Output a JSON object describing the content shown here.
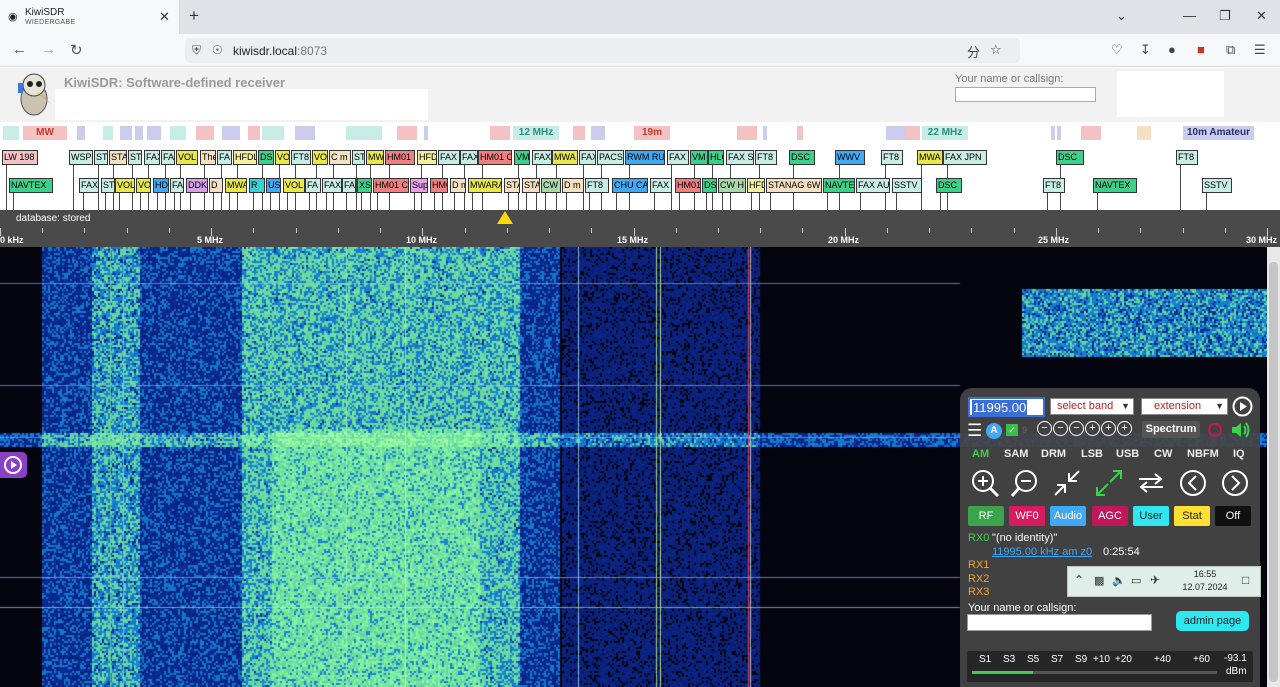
{
  "browser": {
    "tab_title": "KiwiSDR",
    "tab_subtitle": "WIEDERGABE",
    "url_host": "kiwisdr.local",
    "url_port": ":8073"
  },
  "header": {
    "title": "KiwiSDR: Software-defined receiver",
    "callsign_label": "Your name or callsign:"
  },
  "bands": [
    {
      "label": "MW",
      "color": "#f4c2c2",
      "text": "#c0392b"
    },
    {
      "label": "12 MHz",
      "color": "#c8ece6",
      "text": "#2a8f80"
    },
    {
      "label": "19m",
      "color": "#f4c2c2",
      "text": "#c0392b"
    },
    {
      "label": "22 MHz",
      "color": "#c8ece6",
      "text": "#2a8f80"
    },
    {
      "label": "10m Amateur",
      "color": "#ccccee",
      "text": "#223366"
    }
  ],
  "labels_row1": [
    "LW 198",
    "WSP",
    "ST",
    "STA",
    "ST",
    "FAX",
    "FA",
    "VOL",
    "The",
    "FA",
    "HFDL",
    "DS",
    "VO",
    "FT8",
    "VO",
    "C m",
    "ST",
    "MW",
    "HM01",
    "HFD",
    "FAX",
    "FAX",
    "HM01 C",
    "VM",
    "FAX",
    "MWA",
    "FAX",
    "PACS",
    "RWM RU",
    "FAX",
    "VM",
    "HLC",
    "FAX S",
    "FT8",
    "DSC",
    "WWV",
    "FT8",
    "MWA",
    "FAX JPN",
    "DSC",
    "FT8"
  ],
  "labels_row2": [
    "NAVTEX",
    "FAX",
    "ST",
    "VOL",
    "VO",
    "HD",
    "FA",
    "DDK",
    "D",
    "MWA",
    "R",
    "US",
    "VOL",
    "FA",
    "FAX",
    "FA",
    "XS",
    "HM01 C",
    "Sup",
    "HM0",
    "D m",
    "MWARA",
    "STA",
    "STA",
    "CW",
    "D m",
    "FT8",
    "CHU CA",
    "FAX",
    "HM01",
    "DS",
    "CW H",
    "HFD",
    "STANAG 6W",
    "NAVTE",
    "FAX AU",
    "SSTV",
    "DSC",
    "FT8",
    "NAVTEX",
    "SSTV"
  ],
  "scale": {
    "db_label": "database: stored",
    "ticks": [
      "0 kHz",
      "5 MHz",
      "10 MHz",
      "15 MHz",
      "20 MHz",
      "25 MHz",
      "30 MHz"
    ]
  },
  "panel": {
    "frequency": "11995.00",
    "select_band": "select band",
    "extension": "extension",
    "spectrum": "Spectrum",
    "modes": [
      "AM",
      "SAM",
      "DRM",
      "LSB",
      "USB",
      "CW",
      "NBFM",
      "IQ"
    ],
    "buttons": [
      "RF",
      "WF0",
      "Audio",
      "AGC",
      "User",
      "Stat",
      "Off"
    ],
    "rx0_label": "RX0",
    "rx0_identity": "\"(no identity)\"",
    "rx0_link": "11995.00 kHz am z0",
    "rx0_time": "0:25:54",
    "rx1": "RX1",
    "rx2": "RX2",
    "rx3": "RX3",
    "callsign_label": "Your name or callsign:",
    "admin": "admin page",
    "smeter_labels": [
      "S1",
      "S3",
      "S5",
      "S7",
      "S9",
      "+10",
      "+20",
      "+40",
      "+60"
    ],
    "smeter_value": "-93.1",
    "smeter_unit": "dBm",
    "smeter_level": 0.25
  },
  "tray": {
    "time": "16:55",
    "date": "12.07.2024"
  }
}
